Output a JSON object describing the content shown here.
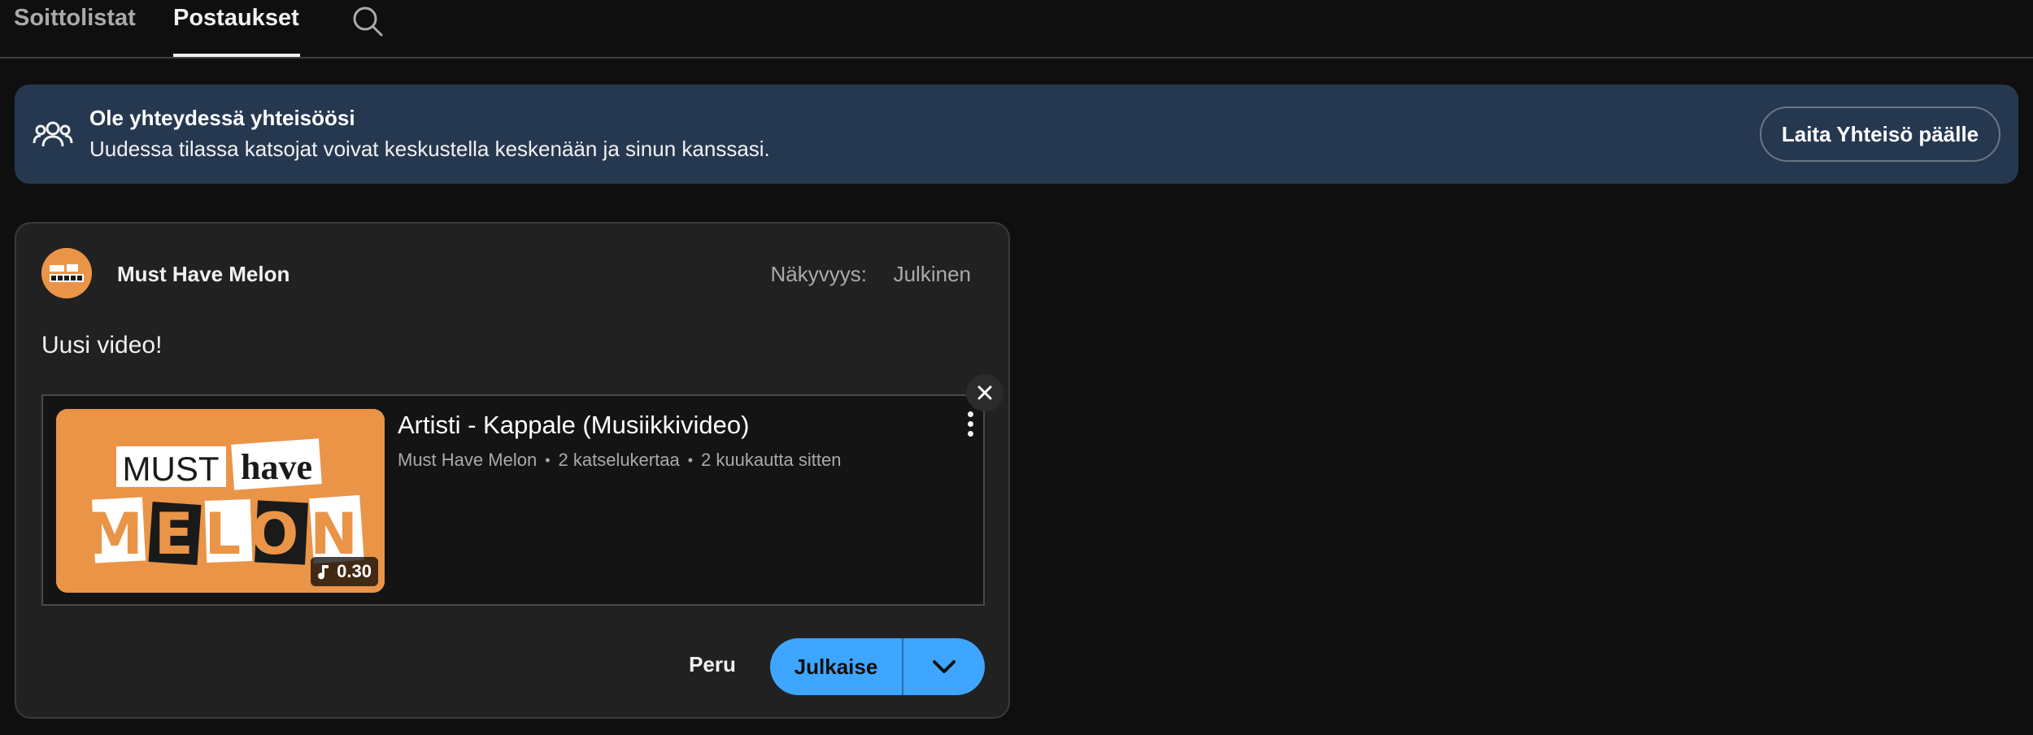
{
  "tabs": {
    "items": [
      {
        "label": "Soittolistat",
        "active": false
      },
      {
        "label": "Postaukset",
        "active": true
      }
    ],
    "search_icon": "search-icon"
  },
  "banner": {
    "icon": "people-icon",
    "title": "Ole yhteydessä yhteisöösi",
    "description": "Uudessa tilassa katsojat voivat keskustella keskenään ja sinun kanssasi.",
    "button_label": "Laita Yhteisö päälle",
    "background_color": "#263850"
  },
  "post": {
    "channel_name": "Must Have Melon",
    "visibility_label": "Näkyvyys:",
    "visibility_value": "Julkinen",
    "text": "Uusi video!",
    "attachment": {
      "title": "Artisti - Kappale (Musiikkivideo)",
      "channel": "Must Have Melon",
      "views": "2 katselukertaa",
      "age": "2 kuukautta sitten",
      "duration": "0.30",
      "thumbnail_lines": [
        "MUST",
        "have",
        "MELON"
      ],
      "thumbnail_color": "#ea9448",
      "close_icon": "close-icon",
      "menu_icon": "more-vert-icon"
    },
    "cancel_label": "Peru",
    "publish_label": "Julkaise",
    "publish_color": "#3ea6ff"
  }
}
